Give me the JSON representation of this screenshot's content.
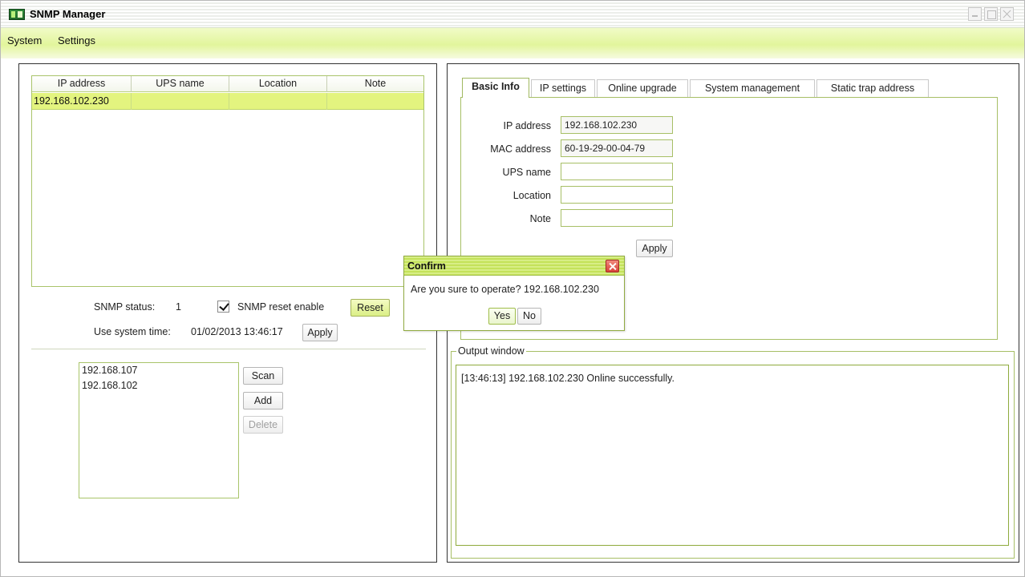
{
  "window": {
    "title": "SNMP Manager",
    "accent_color": "#e2f59c",
    "selection_color": "#e3f47f"
  },
  "menu": {
    "items": [
      {
        "label": "System"
      },
      {
        "label": "Settings"
      }
    ]
  },
  "ups_table": {
    "columns": [
      "IP address",
      "UPS name",
      "Location",
      "Note"
    ],
    "rows": [
      {
        "ip": "192.168.102.230",
        "name": "",
        "location": "",
        "note": "",
        "selected": true
      }
    ]
  },
  "snmp": {
    "status_label": "SNMP status:",
    "status_value": "1",
    "reset_enable_label": "SNMP reset enable",
    "reset_enable_checked": true,
    "reset_button": "Reset",
    "system_time_label": "Use system time:",
    "system_time_value": "01/02/2013 13:46:17",
    "apply_button": "Apply"
  },
  "scan": {
    "ranges": [
      "192.168.107",
      "192.168.102"
    ],
    "scan_button": "Scan",
    "add_button": "Add",
    "delete_button": "Delete",
    "delete_enabled": false
  },
  "tabs": [
    {
      "label": "Basic Info",
      "active": true
    },
    {
      "label": "IP settings",
      "active": false
    },
    {
      "label": "Online upgrade",
      "active": false
    },
    {
      "label": "System management",
      "active": false
    },
    {
      "label": "Static trap address",
      "active": false
    }
  ],
  "basic_info": {
    "ip_label": "IP address",
    "ip_value": "192.168.102.230",
    "mac_label": "MAC address",
    "mac_value": "60-19-29-00-04-79",
    "ups_name_label": "UPS name",
    "ups_name_value": "",
    "location_label": "Location",
    "location_value": "",
    "note_label": "Note",
    "note_value": "",
    "apply_button": "Apply"
  },
  "output": {
    "legend": "Output window",
    "lines": [
      "[13:46:13]  192.168.102.230 Online successfully."
    ]
  },
  "confirm_dialog": {
    "title": "Confirm",
    "message": "Are you sure to operate? 192.168.102.230",
    "yes_button": "Yes",
    "no_button": "No"
  }
}
